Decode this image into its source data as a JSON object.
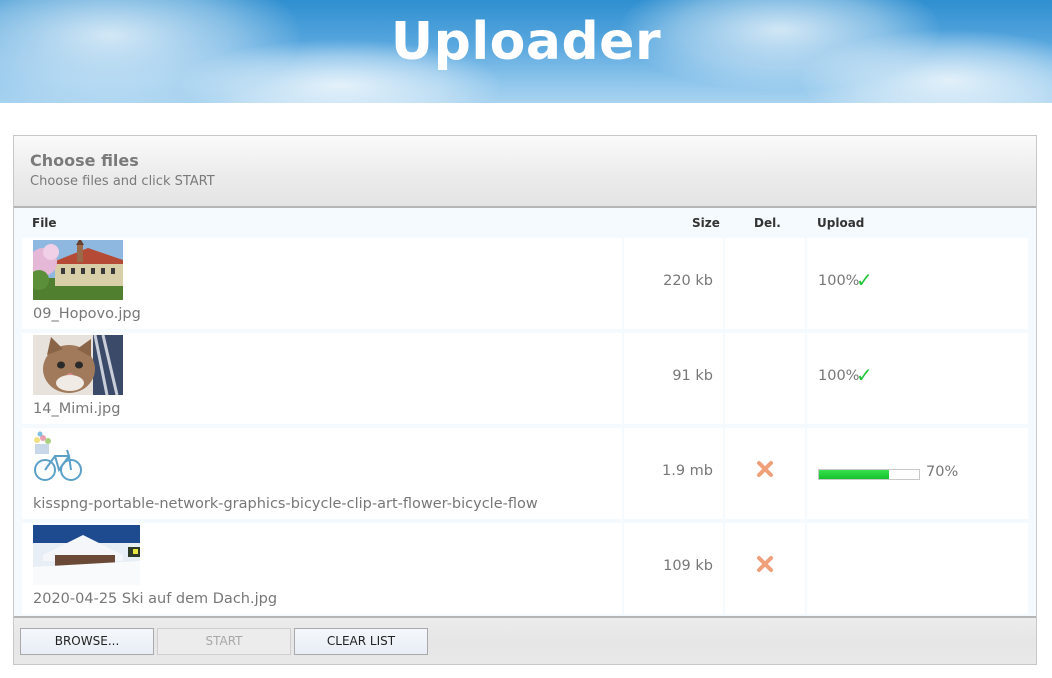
{
  "header": {
    "title": "Uploader"
  },
  "panel": {
    "title": "Choose files",
    "subtitle": "Choose files and click START"
  },
  "columns": {
    "file": "File",
    "size": "Size",
    "del": "Del.",
    "upload": "Upload"
  },
  "files": [
    {
      "name": "09_Hopovo.jpg",
      "size": "220 kb",
      "upload_text": "100%",
      "status": "done",
      "progress": 1.0,
      "deletable": false
    },
    {
      "name": "14_Mimi.jpg",
      "size": "91 kb",
      "upload_text": "100%",
      "status": "done",
      "progress": 1.0,
      "deletable": false
    },
    {
      "name": "kisspng-portable-network-graphics-bicycle-clip-art-flower-bicycle-flow",
      "size": "1.9 mb",
      "upload_text": "70%",
      "status": "uploading",
      "progress": 0.7,
      "deletable": true
    },
    {
      "name": "2020-04-25 Ski auf dem Dach.jpg",
      "size": "109 kb",
      "upload_text": "",
      "status": "pending",
      "progress": 0,
      "deletable": true
    }
  ],
  "footer": {
    "browse_label": "BROWSE...",
    "start_label": "START",
    "clear_label": "CLEAR LIST"
  },
  "colors": {
    "check": "#22c83a",
    "delete": "#f0a07a",
    "progress": "#15c22c"
  },
  "icons": {
    "done": "checkmark-icon",
    "delete": "delete-x-icon"
  }
}
